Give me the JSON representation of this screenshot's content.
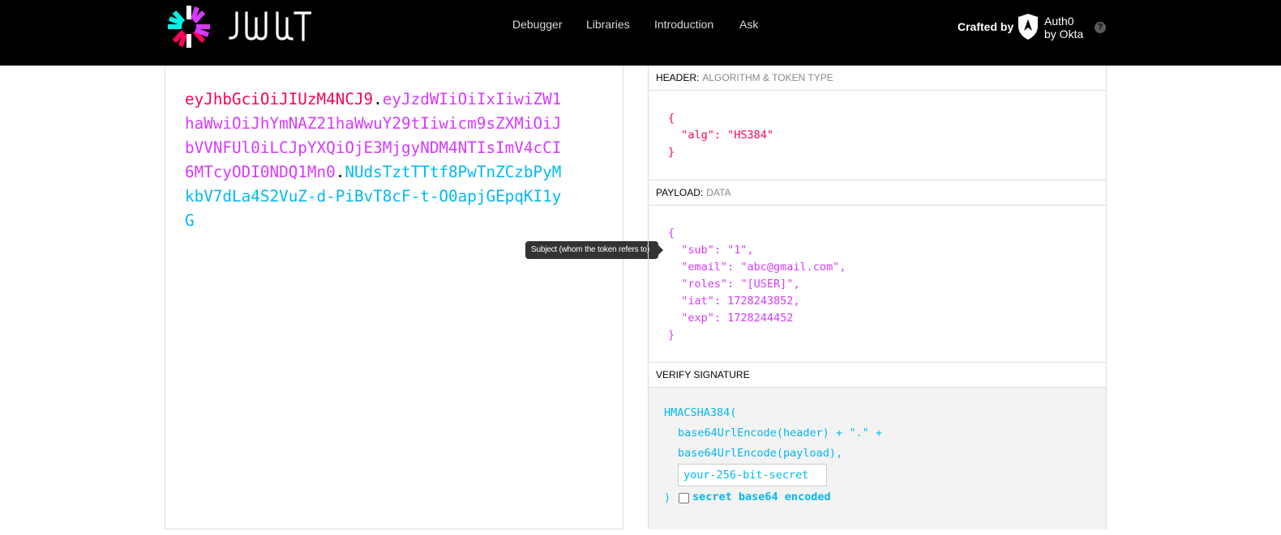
{
  "nav": {
    "logo_icon": "jwt-burst-logo",
    "logo_text": "JWT",
    "links": [
      "Debugger",
      "Libraries",
      "Introduction",
      "Ask"
    ],
    "crafted_by": "Crafted by",
    "brand_line1": "Auth0",
    "brand_line2": "by Okta",
    "help_icon": "?"
  },
  "encoded": {
    "header": "eyJhbGciOiJIUzM4NCJ9",
    "payload": "eyJzdWIiOiIxIiwiZW1haWwiOiJhYmNAZ21haWwuY29tIiwicm9sZXMiOiJbVVNFUl0iLCJpYXQiOjE3MjgyNDM4NTIsImV4cCI6MTcyODI0NDQ1Mn0",
    "signature": "NUdsTztTTtf8PwTnZCzbPyMkbV7dLa4S2VuZ-d-PiBvT8cF-t-O0apjGEpqKI1yG",
    "dot": "."
  },
  "tooltip": "Subject (whom the token refers to)",
  "decoded": {
    "header_title": "HEADER:",
    "header_sub": "ALGORITHM & TOKEN TYPE",
    "header_json": "{\n  \"alg\": \"HS384\"\n}",
    "payload_title": "PAYLOAD:",
    "payload_sub": "DATA",
    "payload_json": "{\n  \"sub\": \"1\",\n  \"email\": \"abc@gmail.com\",\n  \"roles\": \"[USER]\",\n  \"iat\": 1728243852,\n  \"exp\": 1728244452\n}",
    "verify_title": "VERIFY SIGNATURE",
    "verify_fn": "HMACSHA384(",
    "verify_line1": "base64UrlEncode(header) + \".\" +",
    "verify_line2": "base64UrlEncode(payload),",
    "secret_placeholder": "your-256-bit-secret",
    "close_paren": ")",
    "checkbox_label": "secret base64 encoded",
    "checkbox_checked": false
  },
  "colors": {
    "header": "#fb015b",
    "payload": "#d63aff",
    "signature": "#00b9f1"
  }
}
